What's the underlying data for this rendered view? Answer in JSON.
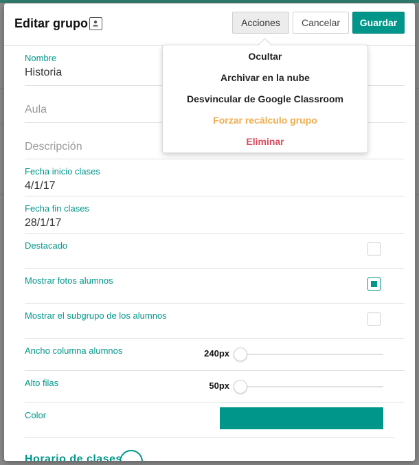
{
  "header": {
    "title": "Editar grupo",
    "title_icon": "contact-card-icon",
    "acciones_label": "Acciones",
    "cancel_label": "Cancelar",
    "save_label": "Guardar"
  },
  "actions_menu": {
    "items": [
      {
        "label": "Ocultar",
        "style": "normal"
      },
      {
        "label": "Archivar en la nube",
        "style": "normal"
      },
      {
        "label": "Desvincular de Google Classroom",
        "style": "normal"
      },
      {
        "label": "Forzar recálculo grupo",
        "style": "warning"
      },
      {
        "label": "Eliminar",
        "style": "danger"
      }
    ]
  },
  "form": {
    "nombre": {
      "label": "Nombre",
      "value": "Historia"
    },
    "aula": {
      "placeholder": "Aula"
    },
    "descripcion": {
      "placeholder": "Descripción"
    },
    "fecha_inicio": {
      "label": "Fecha inicio clases",
      "value": "4/1/17"
    },
    "fecha_fin": {
      "label": "Fecha fin clases",
      "value": "28/1/17"
    },
    "destacado": {
      "label": "Destacado",
      "checked": false
    },
    "mostrar_fotos": {
      "label": "Mostrar fotos alumnos",
      "checked": true
    },
    "mostrar_subgrupo": {
      "label": "Mostrar el subgrupo de los alumnos",
      "checked": false
    },
    "ancho_columna": {
      "label": "Ancho columna alumnos",
      "value": "240px"
    },
    "alto_filas": {
      "label": "Alto filas",
      "value": "50px"
    },
    "color": {
      "label": "Color",
      "value": "#00968a"
    },
    "next_section_partial": "Horario de clases"
  },
  "colors": {
    "accent": "#00968a",
    "warning": "#f0ad4e",
    "danger": "#e04a5f"
  }
}
